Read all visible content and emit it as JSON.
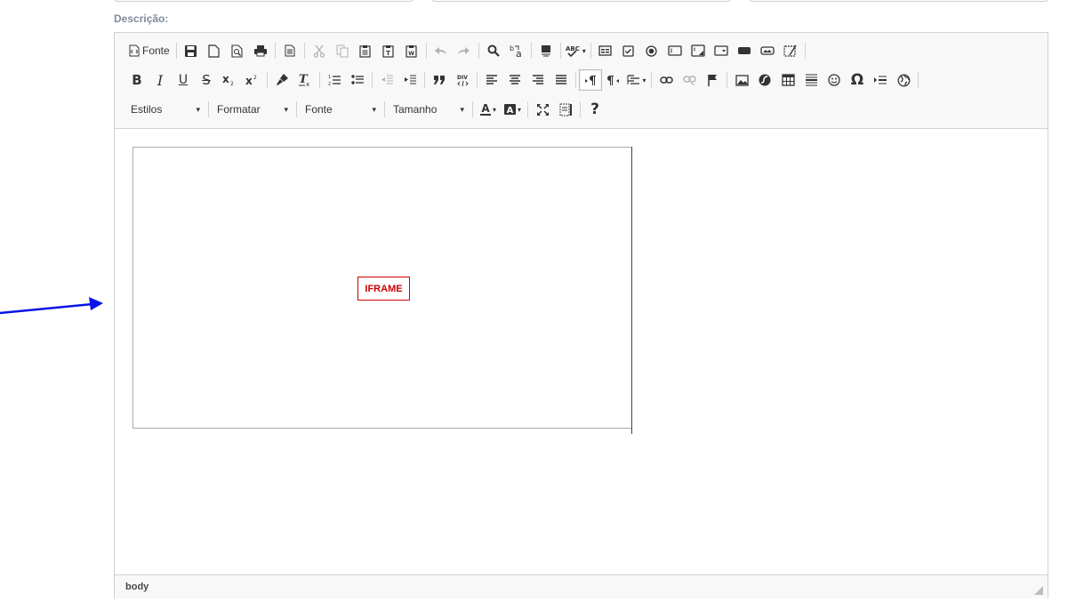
{
  "form": {
    "description_label": "Descrição:"
  },
  "toolbar": {
    "source_label": "Fonte",
    "styles_label": "Estilos",
    "format_label": "Formatar",
    "font_label": "Fonte",
    "size_label": "Tamanho",
    "help_label": "?",
    "bold_label": "B",
    "italic_label": "I",
    "underline_label": "U",
    "strike_label": "S"
  },
  "content": {
    "iframe_placeholder": "IFRAME"
  },
  "statusbar": {
    "element_path": "body"
  },
  "colors": {
    "accent_arrow": "#0a14e6",
    "iframe_red": "#cc0000",
    "label_gray": "#7f8c9a"
  },
  "icons": [
    "source-icon",
    "save-icon",
    "new-page-icon",
    "preview-icon",
    "print-icon",
    "templates-icon",
    "cut-icon",
    "copy-icon",
    "paste-icon",
    "paste-text-icon",
    "paste-word-icon",
    "undo-icon",
    "redo-icon",
    "find-icon",
    "replace-icon",
    "select-all-icon",
    "spellcheck-icon",
    "form-icon",
    "checkbox-icon",
    "radio-icon",
    "textfield-icon",
    "textarea-icon",
    "select-icon",
    "button-icon",
    "image-button-icon",
    "hidden-field-icon",
    "subscript-icon",
    "superscript-icon",
    "copy-format-icon",
    "remove-format-icon",
    "numbered-list-icon",
    "bulleted-list-icon",
    "outdent-icon",
    "indent-icon",
    "blockquote-icon",
    "div-icon",
    "align-left-icon",
    "align-center-icon",
    "align-right-icon",
    "justify-icon",
    "ltr-icon",
    "rtl-icon",
    "language-icon",
    "link-icon",
    "unlink-icon",
    "anchor-icon",
    "image-icon",
    "flash-icon",
    "table-icon",
    "horizontal-rule-icon",
    "smiley-icon",
    "special-char-icon",
    "page-break-icon",
    "iframe-icon",
    "text-color-icon",
    "bg-color-icon",
    "maximize-icon",
    "show-blocks-icon",
    "help-icon",
    "resize-handle-icon"
  ]
}
